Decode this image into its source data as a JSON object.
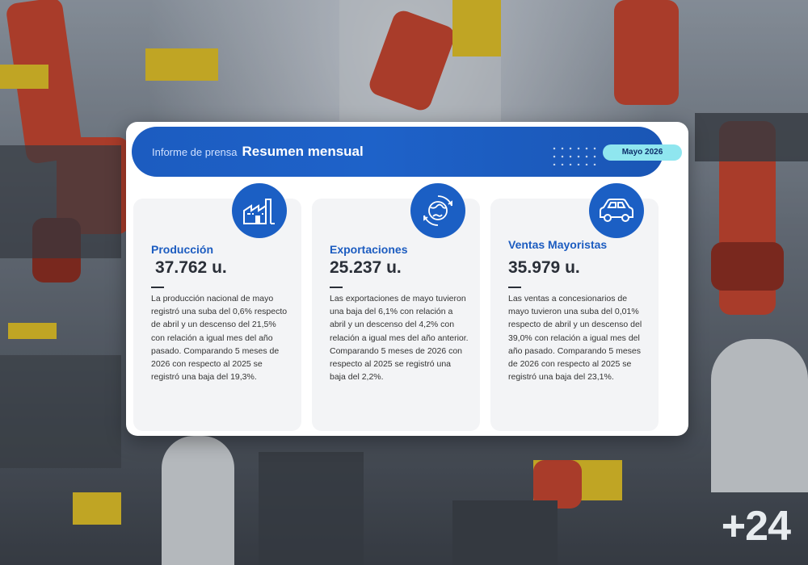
{
  "banner": {
    "subtitle": "Informe de prensa",
    "title": "Resumen mensual",
    "date": "Mayo 2026"
  },
  "stats": [
    {
      "icon": "factory-icon",
      "title": "Producción",
      "value": "37.762 u.",
      "description": "La producción nacional de mayo registró una suba del 0,6% respecto de abril y un descenso del 21,5% con relación a igual mes del año pasado. Comparando 5 meses de 2026 con respecto al 2025 se registró una baja del 19,3%."
    },
    {
      "icon": "globe-icon",
      "title": "Exportaciones",
      "value": "25.237 u.",
      "description": "Las exportaciones de mayo tuvieron una baja del 6,1% con relación a abril y un descenso del 4,2% con relación a igual mes del año anterior. Comparando 5 meses de 2026 con respecto al 2025 se registró una baja del 2,2%."
    },
    {
      "icon": "car-icon",
      "title": "Ventas Mayoristas",
      "value": "35.979 u.",
      "description": "Las ventas a concesionarios de mayo tuvieron una suba del 0,01% respecto de abril y un descenso del 39,0% con relación a igual mes del año pasado. Comparando 5 meses de 2026 con respecto al 2025 se registró una baja del 23,1%."
    }
  ],
  "brand": {
    "logo": "+24"
  },
  "colors": {
    "primary": "#1c5cc0",
    "accent": "#8fe6ef"
  }
}
